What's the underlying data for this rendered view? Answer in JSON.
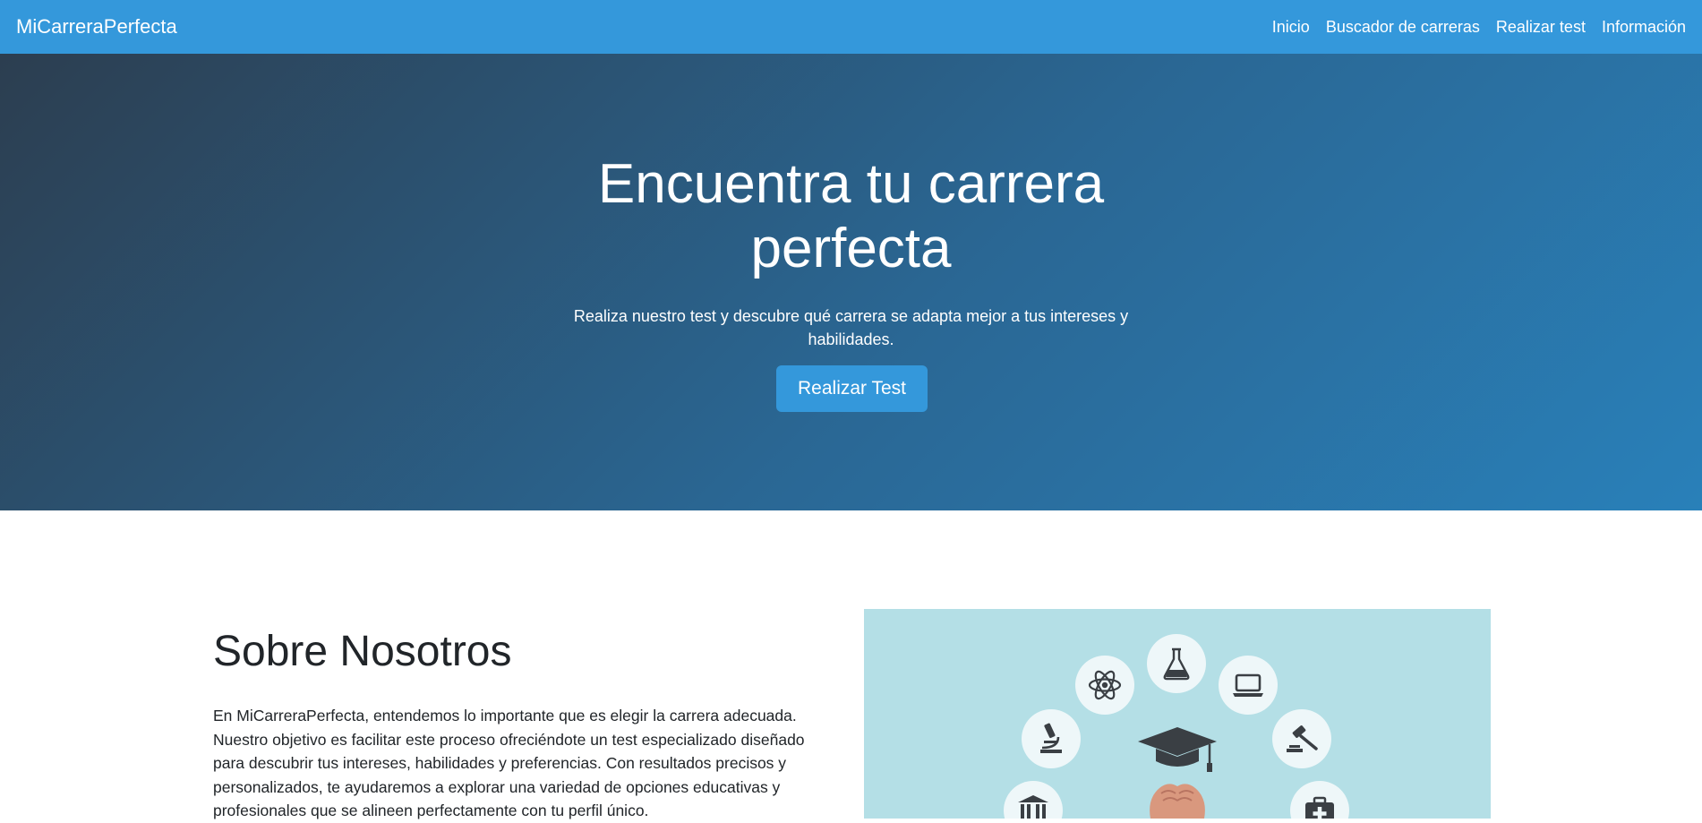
{
  "nav": {
    "brand": "MiCarreraPerfecta",
    "links": [
      "Inicio",
      "Buscador de carreras",
      "Realizar test",
      "Información"
    ]
  },
  "hero": {
    "title": "Encuentra tu carrera perfecta",
    "subtitle": "Realiza nuestro test y descubre qué carrera se adapta mejor a tus intereses y habilidades.",
    "cta_label": "Realizar Test"
  },
  "about": {
    "title": "Sobre Nosotros",
    "text": "En MiCarreraPerfecta, entendemos lo importante que es elegir la carrera adecuada. Nuestro objetivo es facilitar este proceso ofreciéndote un test especializado diseñado para descubrir tus intereses, habilidades y preferencias. Con resultados precisos y personalizados, te ayudaremos a explorar una variedad de opciones educativas y profesionales que se alineen perfectamente con tu perfil único."
  },
  "illustration_icons": [
    "atom-icon",
    "flask-icon",
    "laptop-icon",
    "microscope-icon",
    "graduation-cap-icon",
    "gavel-icon",
    "bank-icon",
    "medical-kit-icon",
    "hands-icon"
  ],
  "colors": {
    "primary": "#3498db",
    "hero_dark": "#2c3e50",
    "hero_light": "#2980b9",
    "illustration_bg": "#b4dfe6",
    "icon": "#3a3f44"
  }
}
